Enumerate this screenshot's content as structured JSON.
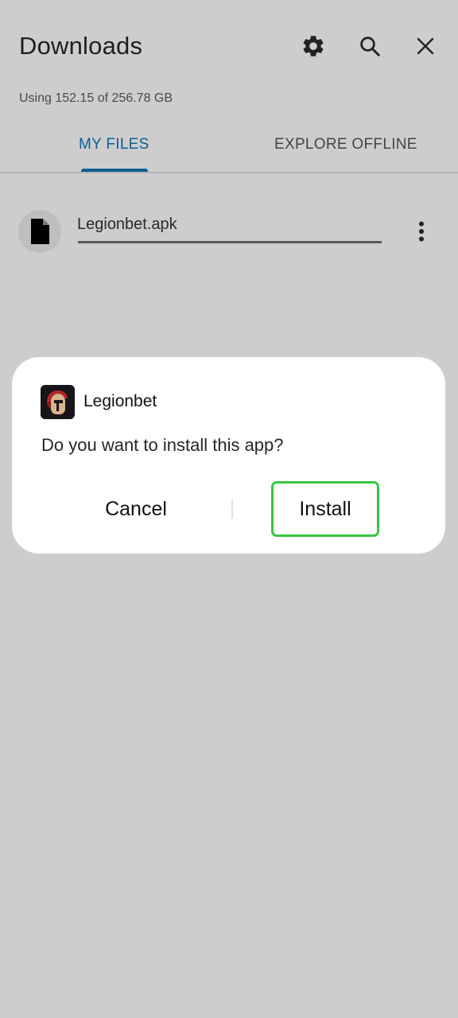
{
  "header": {
    "title": "Downloads",
    "icons": [
      "gear-icon",
      "search-icon",
      "close-icon"
    ]
  },
  "storage": {
    "text": "Using 152.15 of 256.78 GB"
  },
  "tabs": [
    {
      "label": "MY FILES",
      "active": true
    },
    {
      "label": "EXPLORE OFFLINE",
      "active": false
    }
  ],
  "files": [
    {
      "name": "Legionbet.apk",
      "icon": "file-icon",
      "progress": 1.0
    }
  ],
  "dialog": {
    "app_name": "Legionbet",
    "question": "Do you want to install this app?",
    "cancel_label": "Cancel",
    "install_label": "Install"
  },
  "colors": {
    "background": "#cdcdcd",
    "accent": "#0b5f93",
    "install_highlight": "#37c53f",
    "dialog_bg": "#ffffff"
  }
}
